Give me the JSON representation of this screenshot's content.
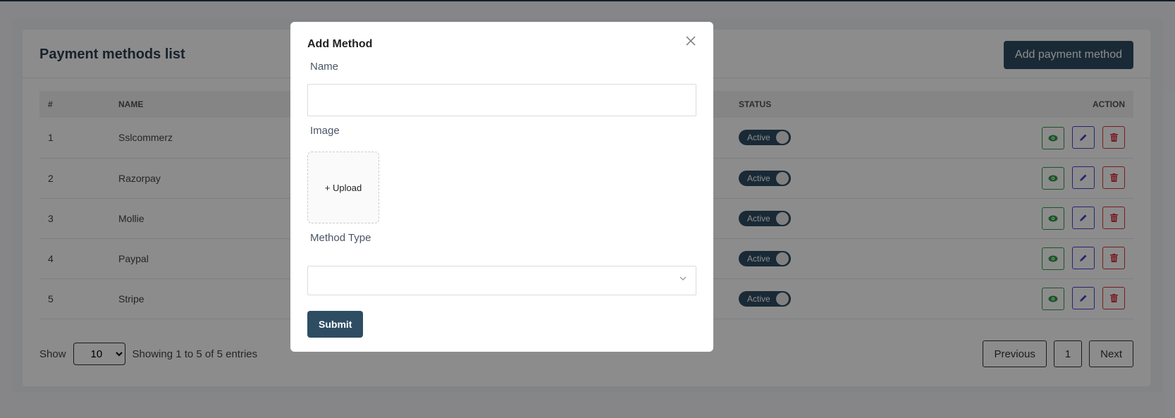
{
  "page": {
    "title": "Payment methods list",
    "add_button": "Add payment method"
  },
  "table": {
    "headers": {
      "index": "#",
      "name": "NAME",
      "status": "STATUS",
      "action": "ACTION"
    },
    "rows": [
      {
        "index": "1",
        "name": "Sslcommerz",
        "status": "Active"
      },
      {
        "index": "2",
        "name": "Razorpay",
        "status": "Active"
      },
      {
        "index": "3",
        "name": "Mollie",
        "status": "Active"
      },
      {
        "index": "4",
        "name": "Paypal",
        "status": "Active"
      },
      {
        "index": "5",
        "name": "Stripe",
        "status": "Active"
      }
    ]
  },
  "footer": {
    "show_label": "Show",
    "page_size": "10",
    "entries_text": "Showing 1 to 5 of 5 entries",
    "pagination": {
      "previous": "Previous",
      "current_page": "1",
      "next": "Next"
    }
  },
  "modal": {
    "title": "Add Method",
    "name_label": "Name",
    "name_value": "",
    "image_label": "Image",
    "upload_text": "+ Upload",
    "method_type_label": "Method Type",
    "method_type_value": "",
    "submit_label": "Submit"
  },
  "icons": {
    "view": "eye-icon",
    "edit": "pencil-icon",
    "delete": "trash-icon",
    "close": "close-icon",
    "dropdown": "chevron-down-icon"
  },
  "colors": {
    "primary": "#2e4d63",
    "view": "#2f9e44",
    "edit": "#4b3fd6",
    "delete": "#d9363e"
  }
}
